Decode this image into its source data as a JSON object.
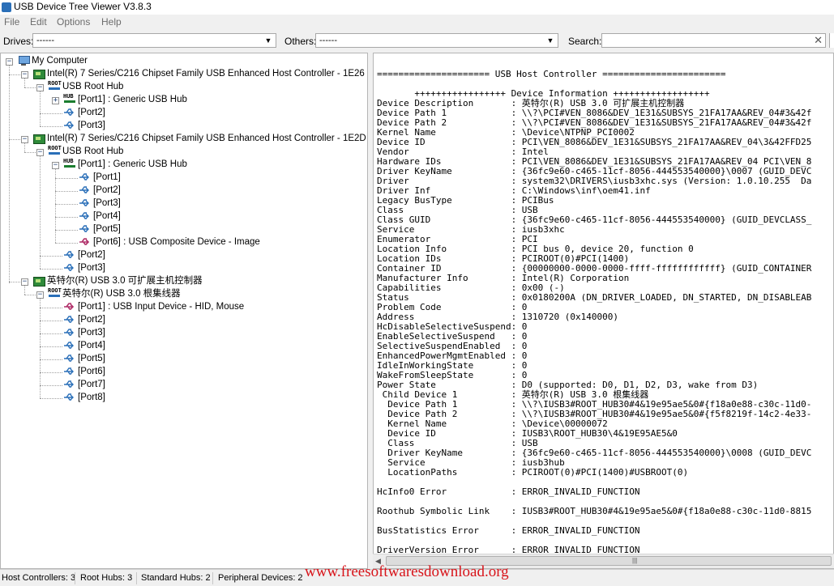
{
  "window": {
    "title": "USB Device Tree Viewer V3.8.3"
  },
  "menu": [
    "File",
    "Edit",
    "Options",
    "Help"
  ],
  "toolbar": {
    "drives_label": "Drives:",
    "drives_value": "------",
    "others_label": "Others:",
    "others_value": "------",
    "search_label": "Search:",
    "search_value": ""
  },
  "tree": {
    "root": "My Computer",
    "nodes": [
      "Intel(R) 7 Series/C216 Chipset Family USB Enhanced Host Controller - 1E26",
      "USB Root Hub",
      "[Port1] : Generic USB Hub",
      "[Port2]",
      "[Port3]",
      "Intel(R) 7 Series/C216 Chipset Family USB Enhanced Host Controller - 1E2D",
      "USB Root Hub",
      "[Port1] : Generic USB Hub",
      "[Port1]",
      "[Port2]",
      "[Port3]",
      "[Port4]",
      "[Port5]",
      "[Port6] : USB Composite Device - Image",
      "[Port2]",
      "[Port3]",
      "英特尔(R) USB 3.0 可扩展主机控制器",
      "英特尔(R) USB 3.0 根集线器",
      "[Port1] : USB Input Device - HID, Mouse",
      "[Port2]",
      "[Port3]",
      "[Port4]",
      "[Port5]",
      "[Port6]",
      "[Port7]",
      "[Port8]"
    ],
    "icon_labels": {
      "root": "ROOT",
      "hub": "HUB"
    }
  },
  "details": {
    "lines": [
      "",
      "===================== USB Host Controller =======================",
      "",
      "       +++++++++++++++++ Device Information ++++++++++++++++++",
      "Device Description       : 英特尔(R) USB 3.0 可扩展主机控制器",
      "Device Path 1            : \\\\?\\PCI#VEN_8086&DEV_1E31&SUBSYS_21FA17AA&REV_04#3&42f",
      "Device Path 2            : \\\\?\\PCI#VEN_8086&DEV_1E31&SUBSYS_21FA17AA&REV_04#3&42f",
      "Kernel Name              : \\Device\\NTPNP_PCI0002",
      "Device ID                : PCI\\VEN_8086&DEV_1E31&SUBSYS_21FA17AA&REV_04\\3&42FFD25",
      "Vendor                   : Intel",
      "Hardware IDs             : PCI\\VEN_8086&DEV_1E31&SUBSYS_21FA17AA&REV_04 PCI\\VEN_8",
      "Driver KeyName           : {36fc9e60-c465-11cf-8056-444553540000}\\0007 (GUID_DEVC",
      "Driver                   : system32\\DRIVERS\\iusb3xhc.sys (Version: 1.0.10.255  Da",
      "Driver Inf               : C:\\Windows\\inf\\oem41.inf",
      "Legacy BusType           : PCIBus",
      "Class                    : USB",
      "Class GUID               : {36fc9e60-c465-11cf-8056-444553540000} (GUID_DEVCLASS_",
      "Service                  : iusb3xhc",
      "Enumerator               : PCI",
      "Location Info            : PCI bus 0, device 20, function 0",
      "Location IDs             : PCIROOT(0)#PCI(1400)",
      "Container ID             : {00000000-0000-0000-ffff-ffffffffffff} (GUID_CONTAINER",
      "Manufacturer Info        : Intel(R) Corporation",
      "Capabilities             : 0x00 (-)",
      "Status                   : 0x0180200A (DN_DRIVER_LOADED, DN_STARTED, DN_DISABLEAB",
      "Problem Code             : 0",
      "Address                  : 1310720 (0x140000)",
      "HcDisableSelectiveSuspend: 0",
      "EnableSelectiveSuspend   : 0",
      "SelectiveSuspendEnabled  : 0",
      "EnhancedPowerMgmtEnabled : 0",
      "IdleInWorkingState       : 0",
      "WakeFromSleepState       : 0",
      "Power State              : D0 (supported: D0, D1, D2, D3, wake from D3)",
      " Child Device 1          : 英特尔(R) USB 3.0 根集线器",
      "  Device Path 1          : \\\\?\\IUSB3#ROOT_HUB30#4&19e95ae5&0#{f18a0e88-c30c-11d0-",
      "  Device Path 2          : \\\\?\\IUSB3#ROOT_HUB30#4&19e95ae5&0#{f5f8219f-14c2-4e33-",
      "  Kernel Name            : \\Device\\00000072",
      "  Device ID              : IUSB3\\ROOT_HUB30\\4&19E95AE5&0",
      "  Class                  : USB",
      "  Driver KeyName         : {36fc9e60-c465-11cf-8056-444553540000}\\0008 (GUID_DEVC",
      "  Service                : iusb3hub",
      "  LocationPaths          : PCIROOT(0)#PCI(1400)#USBROOT(0)",
      "",
      "HcInfo0 Error            : ERROR_INVALID_FUNCTION",
      "",
      "Roothub Symbolic Link    : IUSB3#ROOT_HUB30#4&19e95ae5&0#{f18a0e88-c30c-11d0-8815",
      "",
      "BusStatistics Error      : ERROR_INVALID_FUNCTION",
      "",
      "DriverVersion Error      : ERROR_INVALID_FUNCTION"
    ]
  },
  "status": {
    "host_controllers": "Host Controllers: 3",
    "root_hubs": "Root Hubs: 3",
    "standard_hubs": "Standard Hubs: 2",
    "peripheral_devices": "Peripheral Devices: 2"
  },
  "watermark": "www.freesoftwaresdownload.org",
  "colors": {
    "watermark": "#d8141a",
    "controller_icon": "#2f8a3a",
    "root_hub_bar": "#2a6fb8"
  }
}
